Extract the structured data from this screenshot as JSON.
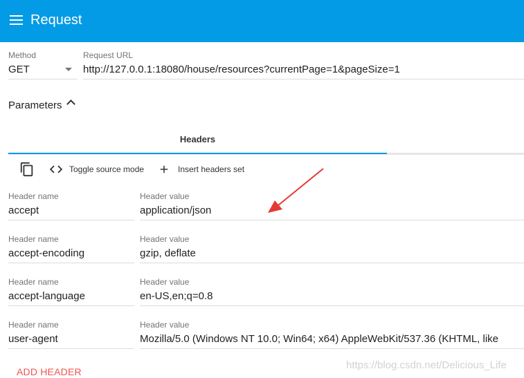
{
  "app_bar": {
    "title": "Request",
    "color": "#039be5"
  },
  "method": {
    "label": "Method",
    "value": "GET"
  },
  "request_url": {
    "label": "Request URL",
    "value": "http://127.0.0.1:18080/house/resources?currentPage=1&pageSize=1"
  },
  "parameters": {
    "label": "Parameters",
    "expanded": true
  },
  "tabs": [
    {
      "label": "Headers",
      "active": true
    }
  ],
  "toolbar": {
    "copy_icon": "content-copy-icon",
    "toggle_source_label": "Toggle source mode",
    "insert_headers_label": "Insert headers set"
  },
  "headers": [
    {
      "name_label": "Header name",
      "name": "accept",
      "value_label": "Header value",
      "value": "application/json"
    },
    {
      "name_label": "Header name",
      "name": "accept-encoding",
      "value_label": "Header value",
      "value": "gzip, deflate"
    },
    {
      "name_label": "Header name",
      "name": "accept-language",
      "value_label": "Header value",
      "value": "en-US,en;q=0.8"
    },
    {
      "name_label": "Header name",
      "name": "user-agent",
      "value_label": "Header value",
      "value": "Mozilla/5.0 (Windows NT 10.0; Win64; x64) AppleWebKit/537.36 (KHTML, like"
    }
  ],
  "add_header_label": "ADD HEADER",
  "watermark": "https://blog.csdn.net/Delicious_Life",
  "annotation_color": "#e53935"
}
